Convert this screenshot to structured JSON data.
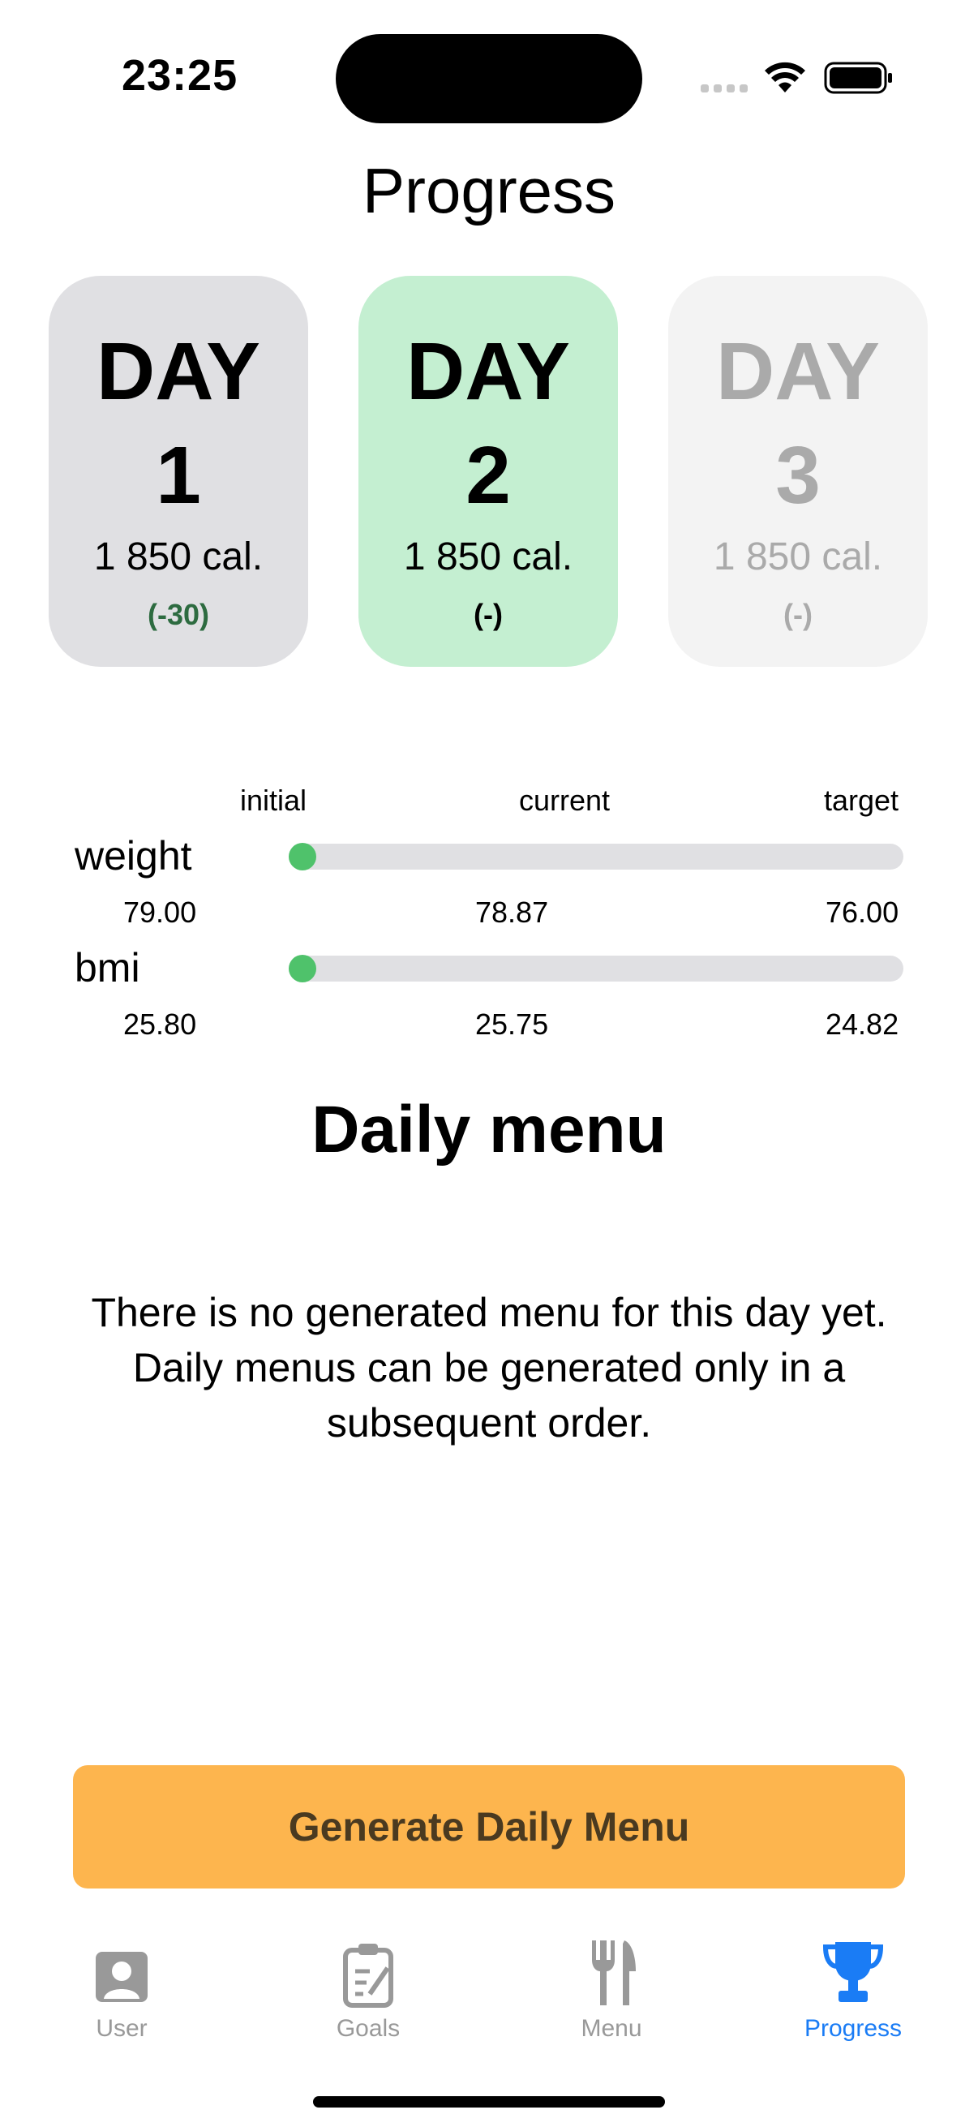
{
  "status_bar": {
    "time": "23:25"
  },
  "title": "Progress",
  "days": [
    {
      "word": "DAY",
      "number": "1",
      "calories": "1 850 cal.",
      "diff": "(-30)"
    },
    {
      "word": "DAY",
      "number": "2",
      "calories": "1 850 cal.",
      "diff": "(-)"
    },
    {
      "word": "DAY",
      "number": "3",
      "calories": "1 850 cal.",
      "diff": "(-)"
    }
  ],
  "stats": {
    "headers": {
      "initial": "initial",
      "current": "current",
      "target": "target"
    },
    "weight": {
      "label": "weight",
      "initial": "79.00",
      "current": "78.87",
      "target": "76.00",
      "progress": 0.0
    },
    "bmi": {
      "label": "bmi",
      "initial": "25.80",
      "current": "25.75",
      "target": "24.82",
      "progress": 0.0
    }
  },
  "daily_menu": {
    "title": "Daily menu",
    "message": "There is no generated menu for this day yet. Daily menus can be generated only in a subsequent order."
  },
  "generate_button": "Generate Daily Menu",
  "tabs": [
    {
      "label": "User",
      "icon": "user-icon"
    },
    {
      "label": "Goals",
      "icon": "goals-clipboard-icon"
    },
    {
      "label": "Menu",
      "icon": "fork-knife-icon"
    },
    {
      "label": "Progress",
      "icon": "trophy-icon",
      "active": true
    }
  ],
  "colors": {
    "accent": "#1a7cf5",
    "button": "#fdb54e",
    "selected_day": "#c4efd1",
    "progress_dot": "#4fc26b"
  }
}
